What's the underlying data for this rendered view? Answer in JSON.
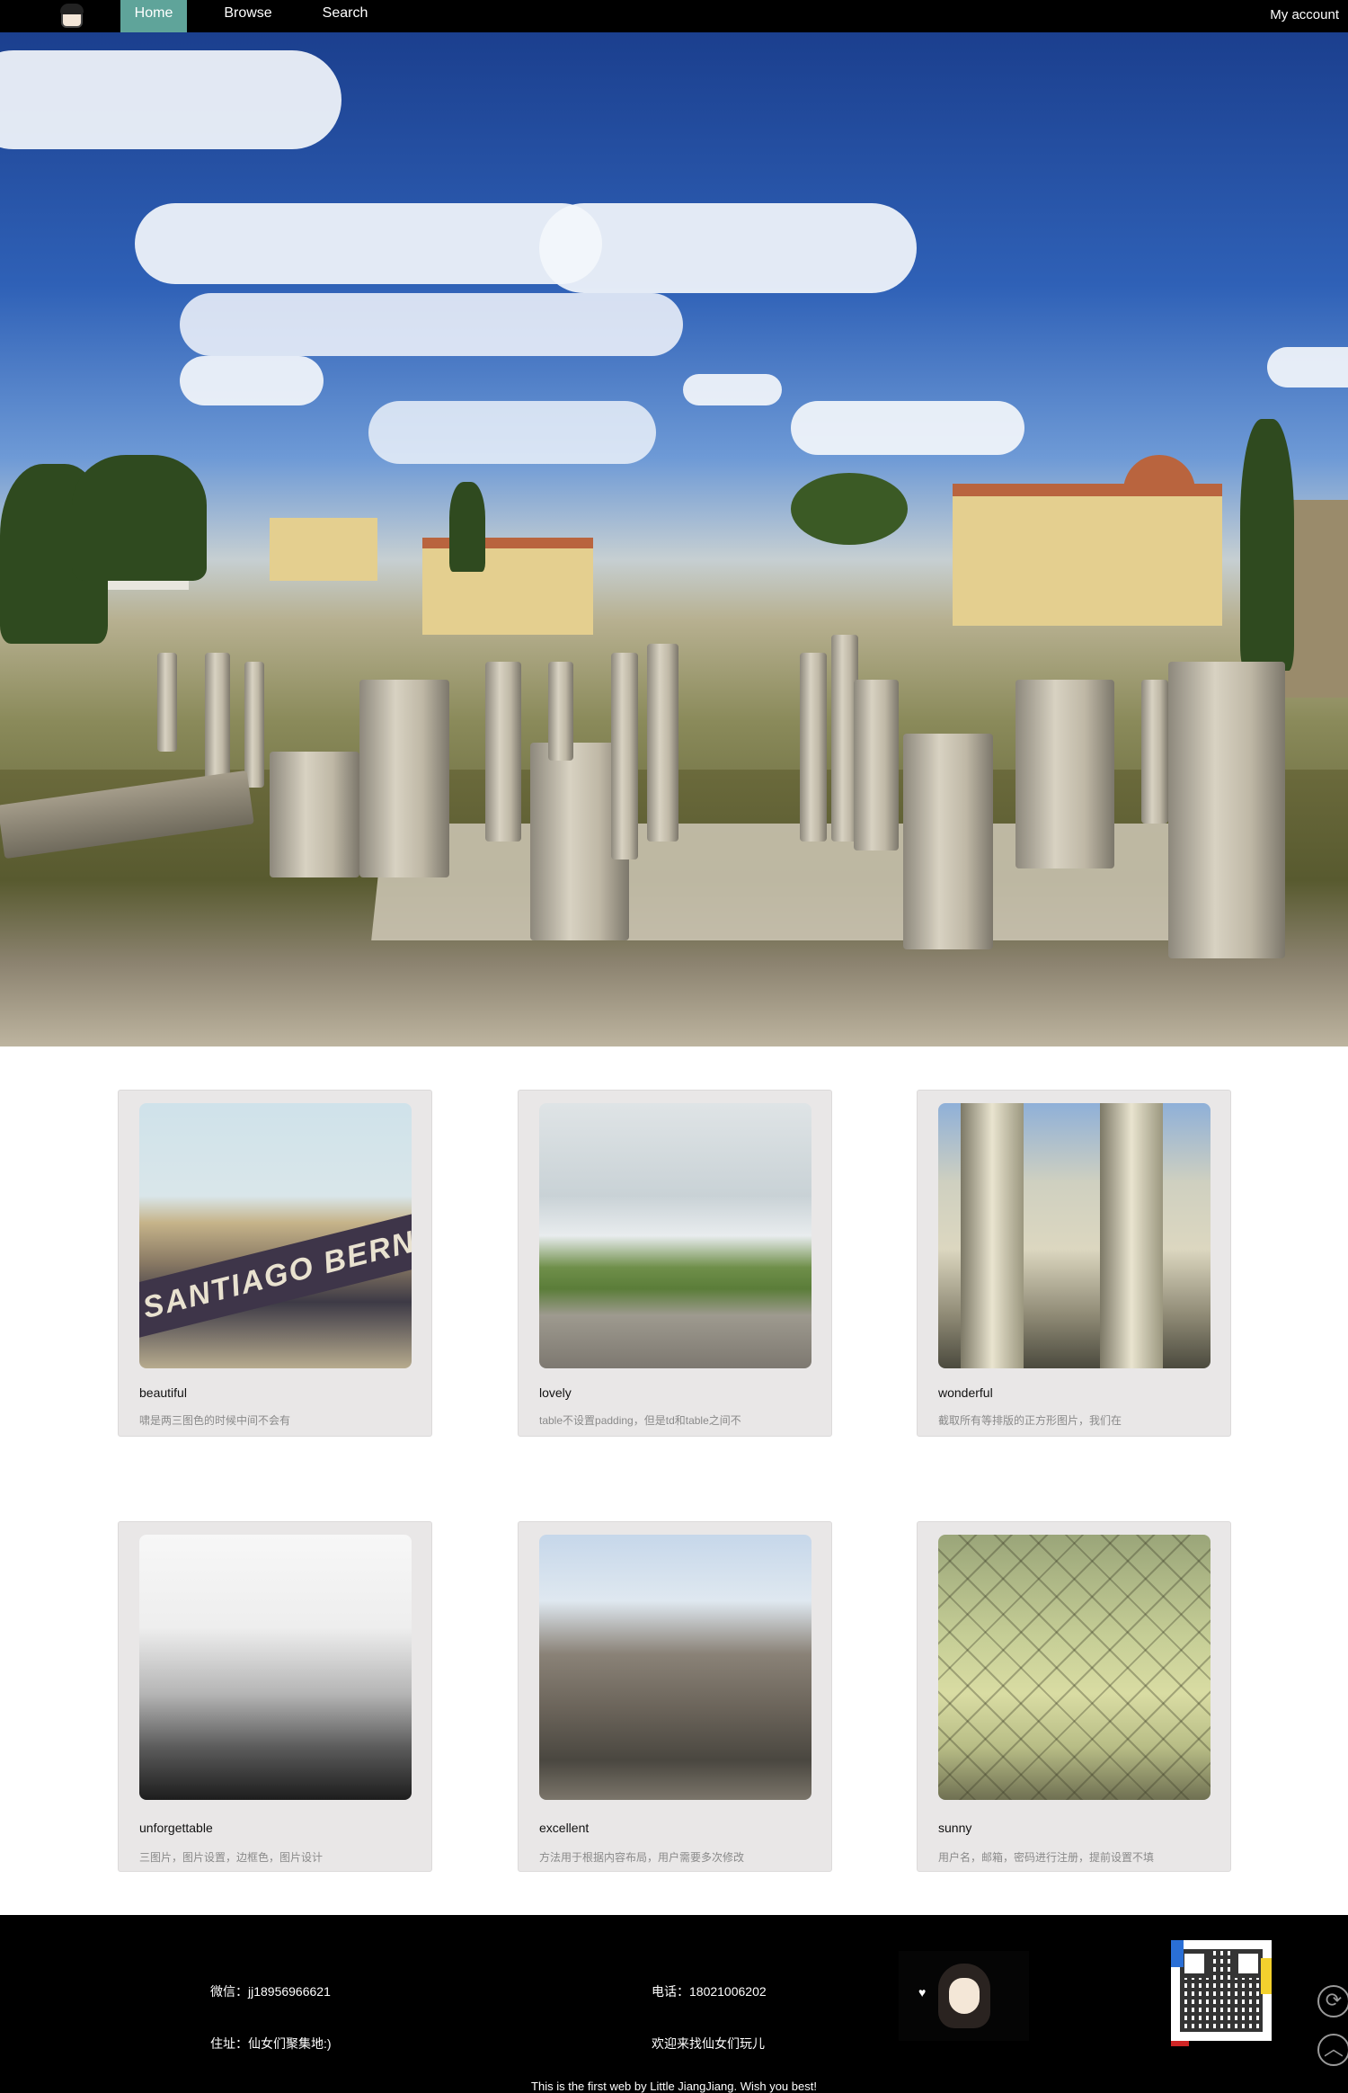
{
  "nav": {
    "logo_icon": "avatar-icon",
    "tabs": [
      {
        "label": "Home",
        "active": true
      },
      {
        "label": "Browse",
        "active": false
      },
      {
        "label": "Search",
        "active": false
      }
    ],
    "account_label": "My account",
    "active_color": "#5fa49a"
  },
  "cards": [
    {
      "title": "beautiful",
      "desc": "啸是两三图色的时候中间不会有"
    },
    {
      "title": "lovely",
      "desc": "table不设置padding，但是td和table之间不"
    },
    {
      "title": "wonderful",
      "desc": "截取所有等排版的正方形图片，我们在"
    },
    {
      "title": "unforgettable",
      "desc": "三图片，图片设置，边框色，图片设计"
    },
    {
      "title": "excellent",
      "desc": "方法用于根据内容布局，用户需要多次修改"
    },
    {
      "title": "sunny",
      "desc": "用户名，邮箱，密码进行注册，提前设置不填"
    }
  ],
  "footer": {
    "wechat": "微信：jj18956966621",
    "address": "住址：仙女们聚集地:)",
    "phone": "电话：18021006202",
    "welcome": "欢迎来找仙女们玩儿",
    "copyright": "This is the first web by Little JiangJiang. Wish you best!",
    "mascot_icon": "girl-mascot-icon",
    "qr_icon": "qr-code-icon",
    "refresh_icon": "refresh-icon",
    "top_icon": "back-to-top-icon",
    "refresh_glyph": "⟳",
    "top_glyph": "︿"
  }
}
